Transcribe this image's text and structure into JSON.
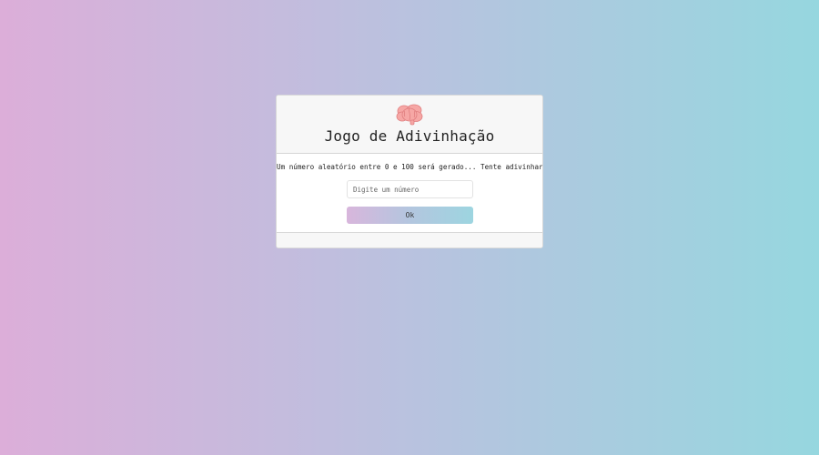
{
  "header": {
    "icon": "brain-icon",
    "icon_color": "#f29a9a",
    "title": "Jogo de Adivinhação"
  },
  "main": {
    "description": "Um número aleatório entre 0 e 100 será gerado... Tente adivinhar!",
    "input": {
      "placeholder": "Digite um número",
      "value": ""
    },
    "ok_label": "Ok"
  },
  "colors": {
    "background_start": "#dcaed9",
    "background_end": "#96d7df"
  }
}
